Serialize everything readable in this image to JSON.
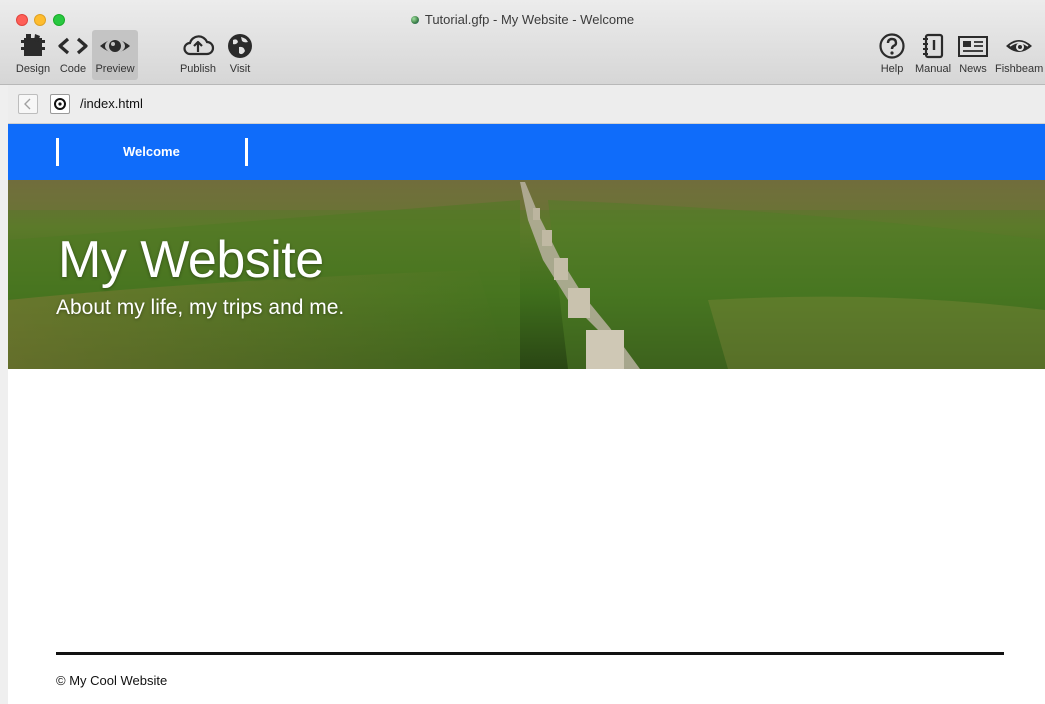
{
  "window": {
    "title": "Tutorial.gfp - My Website - Welcome"
  },
  "toolbar": {
    "left": [
      {
        "label": "Design",
        "icon": "design-icon"
      },
      {
        "label": "Code",
        "icon": "code-icon"
      },
      {
        "label": "Preview",
        "icon": "eye-icon",
        "active": true
      },
      {
        "label": "Publish",
        "icon": "cloud-upload-icon"
      },
      {
        "label": "Visit",
        "icon": "globe-icon"
      }
    ],
    "right": [
      {
        "label": "Help",
        "icon": "help-icon"
      },
      {
        "label": "Manual",
        "icon": "manual-icon"
      },
      {
        "label": "News",
        "icon": "newspaper-icon"
      },
      {
        "label": "Fishbeam",
        "icon": "fishbeam-icon"
      }
    ]
  },
  "address": {
    "path": "/index.html"
  },
  "site": {
    "nav_item": "Welcome",
    "hero_title": "My Website",
    "hero_subtitle": "About my life, my trips and me.",
    "footer": "© My Cool Website"
  },
  "colors": {
    "nav_background": "#0f6cfa",
    "selected_tool_background": "#c4c4c4"
  }
}
